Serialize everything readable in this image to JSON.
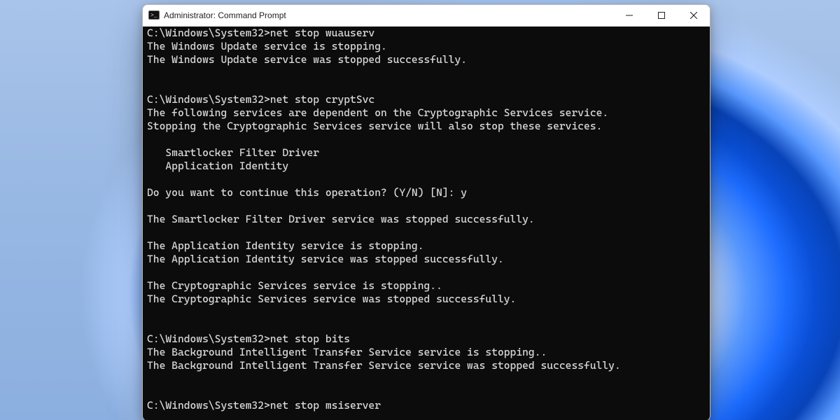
{
  "window": {
    "title": "Administrator: Command Prompt"
  },
  "terminal": {
    "lines": [
      "C:\\Windows\\System32>net stop wuauserv",
      "The Windows Update service is stopping.",
      "The Windows Update service was stopped successfully.",
      "",
      "",
      "C:\\Windows\\System32>net stop cryptSvc",
      "The following services are dependent on the Cryptographic Services service.",
      "Stopping the Cryptographic Services service will also stop these services.",
      "",
      "   Smartlocker Filter Driver",
      "   Application Identity",
      "",
      "Do you want to continue this operation? (Y/N) [N]: y",
      "",
      "The Smartlocker Filter Driver service was stopped successfully.",
      "",
      "The Application Identity service is stopping.",
      "The Application Identity service was stopped successfully.",
      "",
      "The Cryptographic Services service is stopping..",
      "The Cryptographic Services service was stopped successfully.",
      "",
      "",
      "C:\\Windows\\System32>net stop bits",
      "The Background Intelligent Transfer Service service is stopping..",
      "The Background Intelligent Transfer Service service was stopped successfully.",
      "",
      "",
      "C:\\Windows\\System32>net stop msiserver"
    ]
  }
}
